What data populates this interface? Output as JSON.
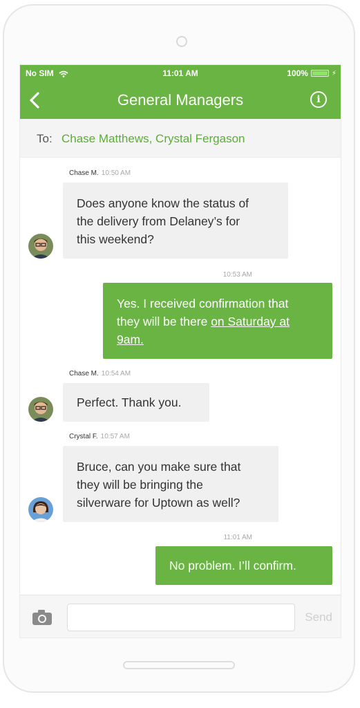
{
  "status_bar": {
    "carrier": "No SIM",
    "time": "11:01 AM",
    "battery": "100%",
    "battery_level": 1.0
  },
  "header": {
    "title": "General Managers",
    "back_icon": "chevron-left-icon",
    "info_icon": "info-circle-icon",
    "info_glyph": "i"
  },
  "recipients": {
    "label": "To:",
    "names": "Chase Matthews, Crystal Fergason"
  },
  "messages": [
    {
      "direction": "incoming",
      "sender": "Chase M.",
      "time": "10:50 AM",
      "lines": [
        "Does anyone know the status of",
        "the delivery from Delaney’s for",
        "this weekend?"
      ]
    },
    {
      "direction": "outgoing",
      "time": "10:53 AM",
      "line1": "Yes. I received confirmation that",
      "line2_prefix": "they will be there ",
      "link": "on Saturday at",
      "line3": "9am."
    },
    {
      "direction": "incoming",
      "sender": "Chase M.",
      "time": "10:54 AM",
      "lines": [
        "Perfect. Thank you."
      ]
    },
    {
      "direction": "incoming",
      "sender": "Crystal F.",
      "time": "10:57 AM",
      "lines": [
        "Bruce, can you make sure that",
        "they will be bringing the",
        "silverware for Uptown as well?"
      ]
    },
    {
      "direction": "outgoing",
      "time": "11:01 AM",
      "lines": [
        "No problem. I’ll confirm."
      ]
    }
  ],
  "composer": {
    "camera_icon": "camera-icon",
    "input_value": "",
    "send_label": "Send"
  },
  "colors": {
    "brand_green": "#6ab444",
    "incoming_bubble": "#f0f0f0",
    "recipient_text": "#5aad36"
  }
}
